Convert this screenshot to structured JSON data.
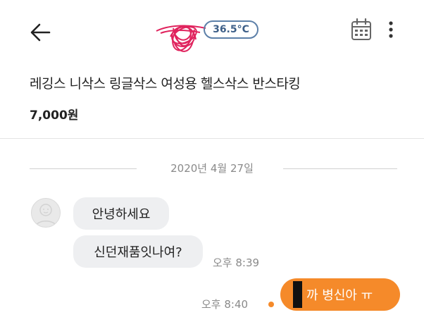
{
  "header": {
    "temperature": "36.5°C",
    "colors": {
      "accent": "#f58a2a",
      "temperature_border": "#5c7fa8",
      "scribble": "#e0245e"
    },
    "icons": [
      "back-arrow-icon",
      "calendar-icon",
      "more-vertical-icon"
    ]
  },
  "product": {
    "title": "레깅스 니삭스 링글삭스 여성용 헬스삭스 반스타킹",
    "price": "7,000원"
  },
  "chat": {
    "date": "2020년 4월 27일",
    "messages": [
      {
        "from": "other",
        "text": "안녕하세요"
      },
      {
        "from": "other",
        "text": "신던재품잇나여?",
        "time": "오후 8:39"
      },
      {
        "from": "me",
        "text": "까 병신아 ㅠ",
        "time": "오후 8:40",
        "unread": true
      }
    ]
  }
}
